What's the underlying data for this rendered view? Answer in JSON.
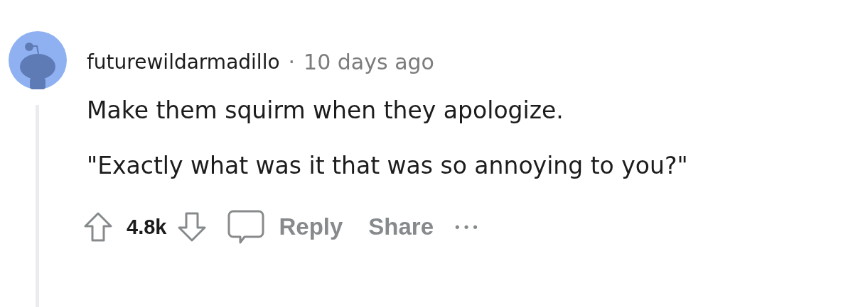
{
  "comment": {
    "author": "futurewildarmadillo",
    "separator": "·",
    "time": "10 days ago",
    "paragraphs": [
      "Make them squirm when they apologize.",
      "\"Exactly what was it that was so annoying to you?\""
    ],
    "score": "4.8k",
    "actions": [
      {
        "kind": "reply",
        "label": "Reply"
      },
      {
        "kind": "share",
        "label": "Share"
      }
    ],
    "more": "•••"
  }
}
